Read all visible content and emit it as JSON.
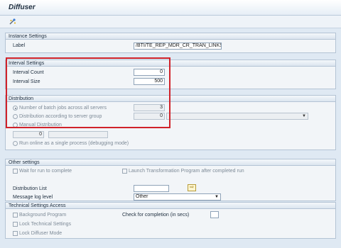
{
  "window": {
    "title": "Diffuser"
  },
  "toolbar": {
    "execute_icon": "execute-icon"
  },
  "instance": {
    "header": "Instance Settings",
    "label_text": "Label",
    "label_value": "/BTI/TE_REP_MDR_CR_TRAN_LINKS"
  },
  "interval": {
    "header": "Interval Settings",
    "count_label": "Interval Count",
    "count_value": "0",
    "size_label": "Interval Size",
    "size_value": "500"
  },
  "distribution": {
    "header": "Distribution",
    "batch_label": "Number of batch jobs across all servers",
    "batch_value": "3",
    "server_group_label": "Distribution according to server group",
    "server_group_value": "0",
    "manual_label": "Manual Distribution",
    "manual_value": "0",
    "online_label": "Run online as a single process (debugging mode)"
  },
  "other": {
    "header": "Other settings",
    "wait_label": "Wait for run to complete",
    "launch_label": "Launch Transformation Program after completed run",
    "dist_list_label": "Distribution List",
    "msg_log_label": "Message log level",
    "msg_log_value": "Other"
  },
  "technical": {
    "header": "Technical Settings Access",
    "background_label": "Background Program",
    "check_completion_label": "Check for completion (in secs)",
    "lock_tech_label": "Lock Technical Settings",
    "lock_diffuser_label": "Lock Diffuser Mode"
  },
  "colors": {
    "highlight": "#d0222a",
    "header_bg": "#dbe5ef"
  }
}
